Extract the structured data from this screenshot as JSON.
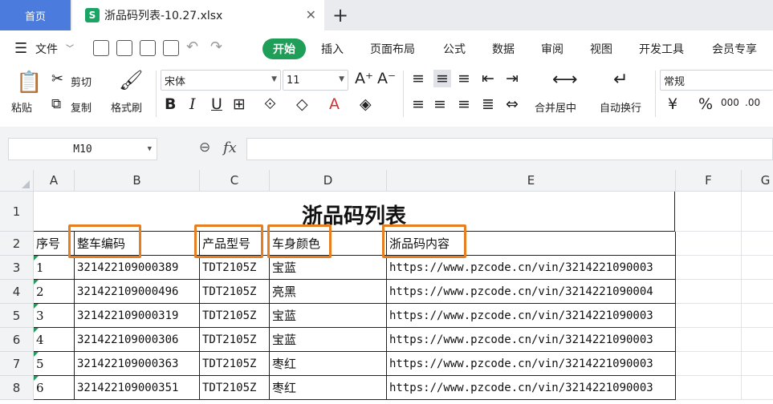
{
  "tabs": {
    "home": "首页",
    "document": "浙品码列表-10.27.xlsx",
    "sheet_icon": "S"
  },
  "menu": {
    "file": "文件",
    "items": [
      "开始",
      "插入",
      "页面布局",
      "公式",
      "数据",
      "审阅",
      "视图",
      "开发工具",
      "会员专享"
    ]
  },
  "ribbon": {
    "paste": "粘贴",
    "cut": "剪切",
    "copy": "复制",
    "format_painter": "格式刷",
    "font_name": "宋体",
    "font_size": "11",
    "merge_center": "合并居中",
    "wrap_text": "自动换行",
    "number_format": "常规"
  },
  "formula_bar": {
    "cell_ref": "M10",
    "fx": "fx",
    "value": ""
  },
  "sheet": {
    "columns": [
      "A",
      "B",
      "C",
      "D",
      "E",
      "F",
      "G"
    ],
    "rows": [
      "1",
      "2",
      "3",
      "4",
      "5",
      "6",
      "7",
      "8"
    ],
    "title": "浙品码列表",
    "headers": [
      "序号",
      "整车编码",
      "产品型号",
      "车身颜色",
      "浙品码内容"
    ],
    "data": [
      [
        "1",
        "321422109000389",
        "TDT2105Z",
        "宝蓝",
        "https://www.pzcode.cn/vin/3214221090003"
      ],
      [
        "2",
        "321422109000496",
        "TDT2105Z",
        "亮黑",
        "https://www.pzcode.cn/vin/3214221090004"
      ],
      [
        "3",
        "321422109000319",
        "TDT2105Z",
        "宝蓝",
        "https://www.pzcode.cn/vin/3214221090003"
      ],
      [
        "4",
        "321422109000306",
        "TDT2105Z",
        "宝蓝",
        "https://www.pzcode.cn/vin/3214221090003"
      ],
      [
        "5",
        "321422109000363",
        "TDT2105Z",
        "枣红",
        "https://www.pzcode.cn/vin/3214221090003"
      ],
      [
        "6",
        "321422109000351",
        "TDT2105Z",
        "枣红",
        "https://www.pzcode.cn/vin/3214221090003"
      ]
    ]
  },
  "colors": {
    "accent": "#1e9e57",
    "home_tab": "#4b7bdc",
    "highlight": "#e67e22"
  }
}
